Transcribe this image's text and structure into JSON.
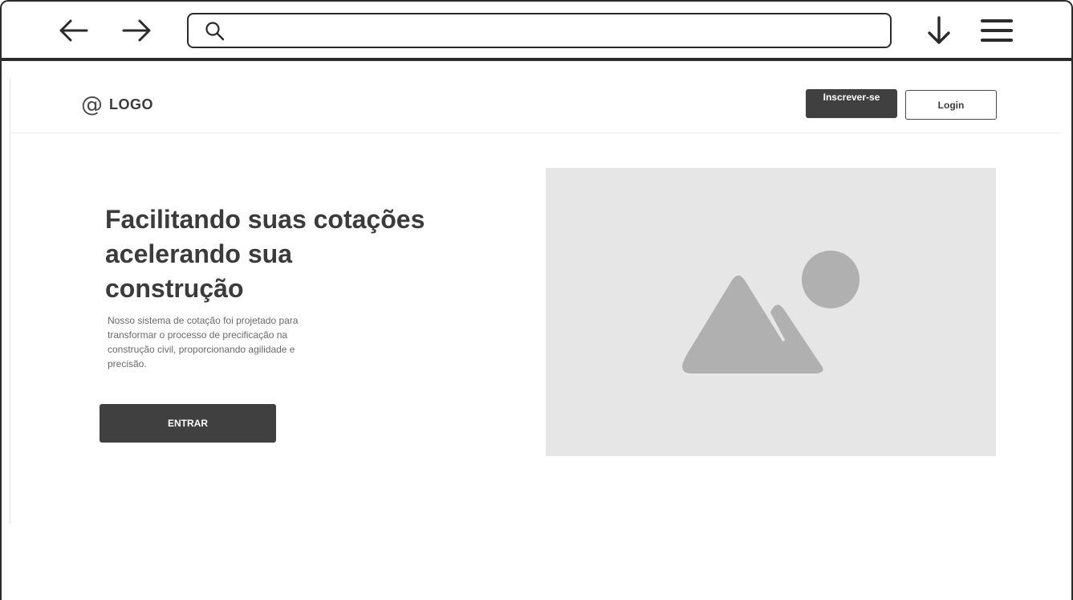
{
  "browser": {
    "address_value": "",
    "icons": {
      "back": "arrow-left-icon",
      "forward": "arrow-right-icon",
      "search": "search-icon",
      "download": "arrow-down-icon",
      "menu": "hamburger-menu-icon"
    }
  },
  "header": {
    "logo_symbol": "@",
    "logo_text": "LOGO",
    "signup_label": "Inscrever-se",
    "login_label": "Login"
  },
  "hero": {
    "title_line1": "Facilitando suas cotações",
    "title_line2": "acelerando sua",
    "title_line3": "construção",
    "desc_line1": "Nosso sistema de cotação foi projetado para",
    "desc_line2": "transformar o processo de precificação na",
    "desc_line3": "construção civil, proporcionando agilidade e",
    "desc_line4": "precisão.",
    "cta_label": "ENTRAR",
    "image_icon": "image-placeholder-icon"
  },
  "colors": {
    "dark": "#404040",
    "text": "#3b3b3b",
    "muted": "#6a6a6a",
    "placeholder_bg": "#e6e6e6",
    "placeholder_shape": "#b0b0b0"
  }
}
